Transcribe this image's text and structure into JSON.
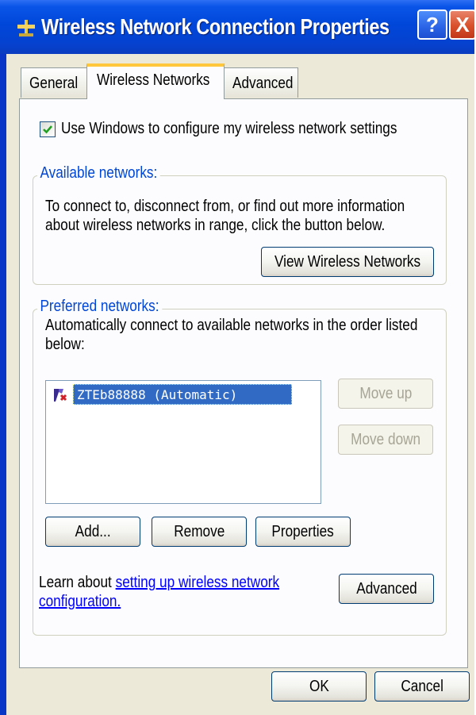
{
  "window": {
    "title": "Wireless Network Connection Properties",
    "help_button": "?",
    "close_button": "X"
  },
  "tabs": [
    {
      "label": "General",
      "selected": false
    },
    {
      "label": "Wireless Networks",
      "selected": true
    },
    {
      "label": "Advanced",
      "selected": false
    }
  ],
  "use_windows_checkbox": {
    "label": "Use Windows to configure my wireless network settings",
    "checked": true
  },
  "available_networks": {
    "heading": "Available networks:",
    "description_line1": "To connect to, disconnect from, or find out more information",
    "description_line2": "about wireless networks in range, click the button below.",
    "view_button": "View Wireless Networks"
  },
  "preferred_networks": {
    "heading": "Preferred networks:",
    "description_line1": "Automatically connect to available networks in the order listed",
    "description_line2": "below:",
    "items": [
      {
        "label": "ZTEb88888  (Automatic)",
        "selected": true,
        "icon": "wireless-network-icon"
      }
    ],
    "move_up_button": "Move up",
    "move_down_button": "Move down",
    "add_button": "Add...",
    "remove_button": "Remove",
    "properties_button": "Properties",
    "learn_prefix": "Learn about ",
    "learn_link_line1": "setting up wireless network",
    "learn_link_line2": "configuration.",
    "advanced_button": "Advanced"
  },
  "footer": {
    "ok_button": "OK",
    "cancel_button": "Cancel"
  },
  "colors": {
    "title_bar": "#0047d9",
    "dialog_face": "#ece9d8",
    "group_heading": "#0046d5",
    "selection": "#316ac5",
    "selected_tab_accent": "#ffc83c"
  }
}
